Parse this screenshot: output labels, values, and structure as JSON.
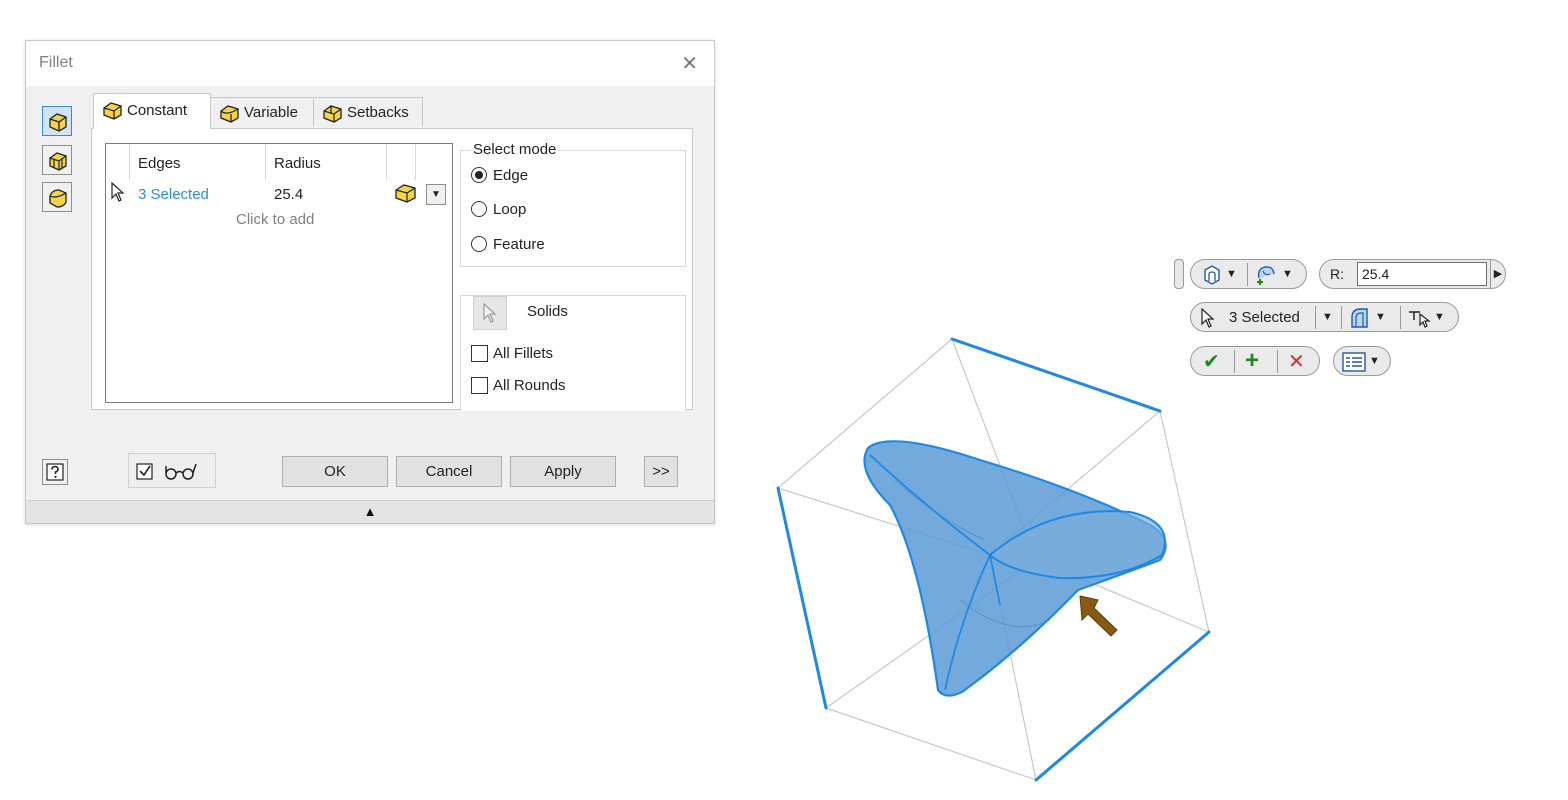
{
  "dialog": {
    "title": "Fillet",
    "tabs": [
      {
        "label": "Constant",
        "active": true
      },
      {
        "label": "Variable",
        "active": false
      },
      {
        "label": "Setbacks",
        "active": false
      }
    ],
    "table": {
      "headers": {
        "edges": "Edges",
        "radius": "Radius"
      },
      "rows": [
        {
          "edges": "3 Selected",
          "radius": "25.4"
        }
      ],
      "add_row_text": "Click to add"
    },
    "select_mode": {
      "legend": "Select mode",
      "options": [
        "Edge",
        "Loop",
        "Feature"
      ],
      "selected": "Edge"
    },
    "solids_label": "Solids",
    "checks": [
      {
        "label": "All Fillets",
        "checked": false
      },
      {
        "label": "All Rounds",
        "checked": false
      }
    ],
    "buttons": {
      "ok": "OK",
      "cancel": "Cancel",
      "apply": "Apply",
      "more": ">>"
    },
    "preview_checked": true,
    "collapse_glyph": "▲"
  },
  "mini_toolbar": {
    "radius_label": "R:",
    "radius_value": "25.4",
    "selection_label": "3 Selected"
  },
  "colors": {
    "accent": "#2d8ddf",
    "solid_fill": "#5b9bd5",
    "edge_highlight": "#1e88e5",
    "arrow": "#8b5a12",
    "ok_green": "#1a8a1a",
    "cancel_red": "#d32f2f",
    "icon_yellow": "#f3d34a"
  }
}
